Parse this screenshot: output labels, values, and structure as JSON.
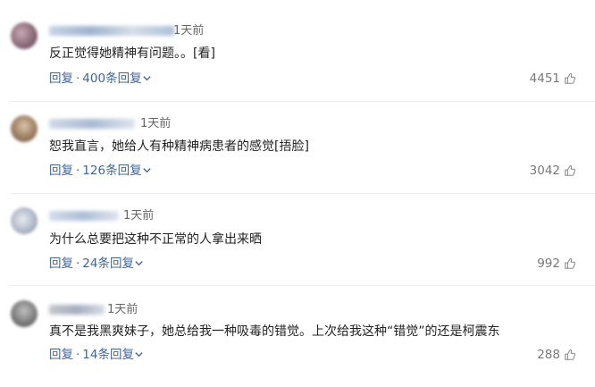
{
  "comments": [
    {
      "time": "1天前",
      "text": "反正觉得她精神有问题。。[看]",
      "reply_label": "回复",
      "replies_label": "400条回复",
      "likes": "4451"
    },
    {
      "time": "1天前",
      "text": "恕我直言，她给人有种精神病患者的感觉[捂脸]",
      "reply_label": "回复",
      "replies_label": "126条回复",
      "likes": "3042"
    },
    {
      "time": "1天前",
      "text": "为什么总要把这种不正常的人拿出来晒",
      "reply_label": "回复",
      "replies_label": "24条回复",
      "likes": "992"
    },
    {
      "time": "1天前",
      "text": "真不是我黑爽妹子，她总给我一种吸毒的错觉。上次给我这种“错觉”的还是柯震东",
      "reply_label": "回复",
      "replies_label": "14条回复",
      "likes": "288"
    }
  ],
  "colors": {
    "link": "#406599",
    "secondary_text": "#777777",
    "divider": "#ececec"
  },
  "icons": {
    "like": "thumbs-up-icon",
    "expand": "chevron-down-icon"
  }
}
